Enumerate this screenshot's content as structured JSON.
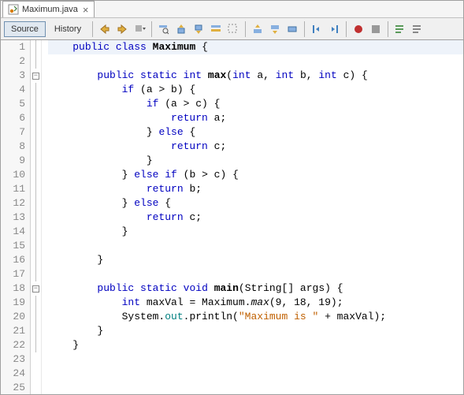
{
  "tab": {
    "label": "Maximum.java"
  },
  "toolbar": {
    "source": "Source",
    "history": "History"
  },
  "code": {
    "total_lines": 25,
    "fold_lines": [
      3,
      18
    ],
    "highlight_line": 1,
    "lines": [
      {
        "n": 1,
        "tokens": [
          [
            "",
            "    "
          ],
          [
            "kw",
            "public"
          ],
          [
            "",
            " "
          ],
          [
            "kw",
            "class"
          ],
          [
            "",
            " "
          ],
          [
            "bold",
            "Maximum"
          ],
          [
            "",
            " {"
          ]
        ]
      },
      {
        "n": 2,
        "tokens": []
      },
      {
        "n": 3,
        "tokens": [
          [
            "",
            "        "
          ],
          [
            "kw",
            "public"
          ],
          [
            "",
            " "
          ],
          [
            "kw",
            "static"
          ],
          [
            "",
            " "
          ],
          [
            "type",
            "int"
          ],
          [
            "",
            " "
          ],
          [
            "bold",
            "max"
          ],
          [
            "",
            "("
          ],
          [
            "type",
            "int"
          ],
          [
            "",
            " a, "
          ],
          [
            "type",
            "int"
          ],
          [
            "",
            " b, "
          ],
          [
            "type",
            "int"
          ],
          [
            "",
            " c) {"
          ]
        ]
      },
      {
        "n": 4,
        "tokens": [
          [
            "",
            "            "
          ],
          [
            "kw",
            "if"
          ],
          [
            "",
            " (a > b) {"
          ]
        ]
      },
      {
        "n": 5,
        "tokens": [
          [
            "",
            "                "
          ],
          [
            "kw",
            "if"
          ],
          [
            "",
            " (a > c) {"
          ]
        ]
      },
      {
        "n": 6,
        "tokens": [
          [
            "",
            "                    "
          ],
          [
            "kw",
            "return"
          ],
          [
            "",
            " a;"
          ]
        ]
      },
      {
        "n": 7,
        "tokens": [
          [
            "",
            "                } "
          ],
          [
            "kw",
            "else"
          ],
          [
            "",
            " {"
          ]
        ]
      },
      {
        "n": 8,
        "tokens": [
          [
            "",
            "                    "
          ],
          [
            "kw",
            "return"
          ],
          [
            "",
            " c;"
          ]
        ]
      },
      {
        "n": 9,
        "tokens": [
          [
            "",
            "                }"
          ]
        ]
      },
      {
        "n": 10,
        "tokens": [
          [
            "",
            "            } "
          ],
          [
            "kw",
            "else"
          ],
          [
            "",
            " "
          ],
          [
            "kw",
            "if"
          ],
          [
            "",
            " (b > c) {"
          ]
        ]
      },
      {
        "n": 11,
        "tokens": [
          [
            "",
            "                "
          ],
          [
            "kw",
            "return"
          ],
          [
            "",
            " b;"
          ]
        ]
      },
      {
        "n": 12,
        "tokens": [
          [
            "",
            "            } "
          ],
          [
            "kw",
            "else"
          ],
          [
            "",
            " {"
          ]
        ]
      },
      {
        "n": 13,
        "tokens": [
          [
            "",
            "                "
          ],
          [
            "kw",
            "return"
          ],
          [
            "",
            " c;"
          ]
        ]
      },
      {
        "n": 14,
        "tokens": [
          [
            "",
            "            }"
          ]
        ]
      },
      {
        "n": 15,
        "tokens": []
      },
      {
        "n": 16,
        "tokens": [
          [
            "",
            "        }"
          ]
        ]
      },
      {
        "n": 17,
        "tokens": []
      },
      {
        "n": 18,
        "tokens": [
          [
            "",
            "        "
          ],
          [
            "kw",
            "public"
          ],
          [
            "",
            " "
          ],
          [
            "kw",
            "static"
          ],
          [
            "",
            " "
          ],
          [
            "type",
            "void"
          ],
          [
            "",
            " "
          ],
          [
            "bold",
            "main"
          ],
          [
            "",
            "(String[] args) {"
          ]
        ]
      },
      {
        "n": 19,
        "tokens": [
          [
            "",
            "            "
          ],
          [
            "type",
            "int"
          ],
          [
            "",
            " maxVal = Maximum."
          ],
          [
            "i",
            "max"
          ],
          [
            "",
            "(9, 18, 19);"
          ]
        ]
      },
      {
        "n": 20,
        "tokens": [
          [
            "",
            "            System."
          ],
          [
            "fld",
            "out"
          ],
          [
            "",
            ".println("
          ],
          [
            "str",
            "\"Maximum is \""
          ],
          [
            "",
            " + maxVal);"
          ]
        ]
      },
      {
        "n": 21,
        "tokens": [
          [
            "",
            "        }"
          ]
        ]
      },
      {
        "n": 22,
        "tokens": [
          [
            "",
            "    }"
          ]
        ]
      },
      {
        "n": 23,
        "tokens": []
      },
      {
        "n": 24,
        "tokens": []
      },
      {
        "n": 25,
        "tokens": []
      }
    ]
  }
}
